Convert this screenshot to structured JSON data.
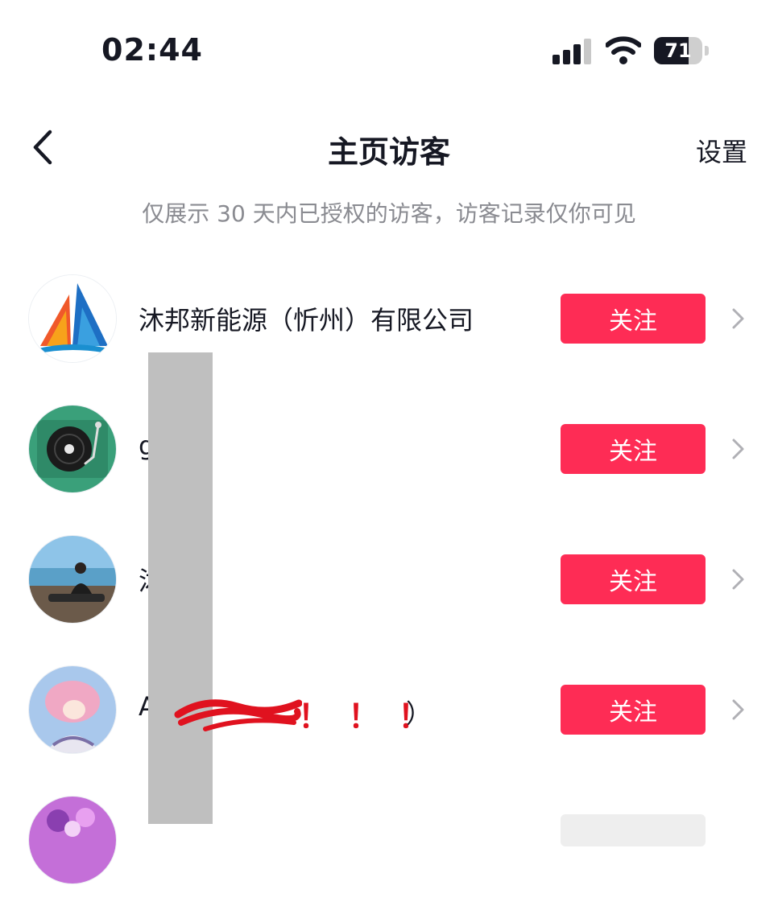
{
  "status_bar": {
    "time": "02:44",
    "battery": "71",
    "battery_level": 0.71
  },
  "nav": {
    "title": "主页访客",
    "settings_label": "设置",
    "back_icon": "chevron-left-icon"
  },
  "notice": "仅展示 30 天内已授权的访客，访客记录仅你可见",
  "visitors": [
    {
      "name": "沐邦新能源（忻州）有限公司",
      "button": "关注"
    },
    {
      "name": "g      al",
      "button": "关注"
    },
    {
      "name": "沐",
      "button": "关注"
    },
    {
      "name": "A",
      "button": "关注"
    }
  ],
  "row4_extra": {
    "exclaims": "！！！",
    "paren": "）"
  },
  "colors": {
    "accent": "#fe2c55",
    "text": "#161823",
    "muted": "#8a8b91",
    "redaction": "#bfbfbf",
    "scribble": "#e0121f"
  }
}
